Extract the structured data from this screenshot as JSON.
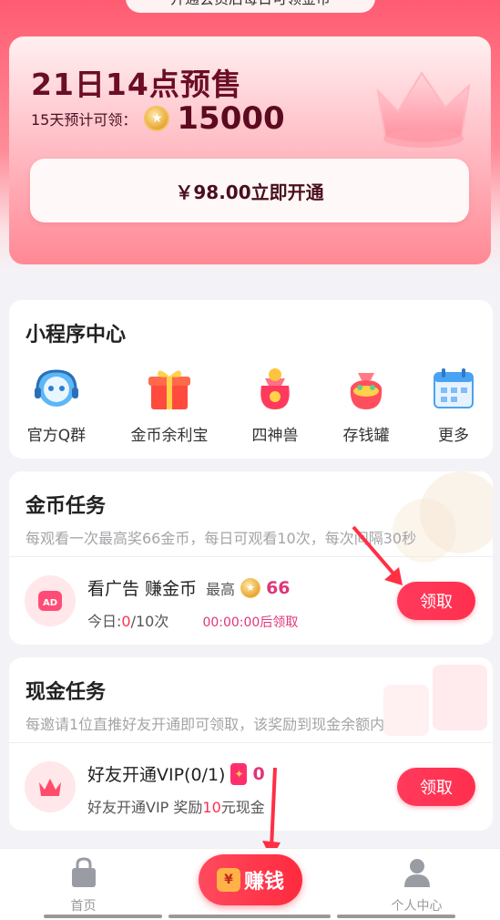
{
  "top_pill": {
    "text": "开通会员后每日可领金币"
  },
  "promo": {
    "title": "21日14点预售",
    "sub_label": "15天预计可领：",
    "amount": "15000",
    "open_button_label": "￥98.00立即开通"
  },
  "mini_center": {
    "title": "小程序中心",
    "items": [
      {
        "label": "官方Q群",
        "icon": "robot-headset-icon"
      },
      {
        "label": "金币余利宝",
        "icon": "gift-box-icon"
      },
      {
        "label": "四神兽",
        "icon": "lucky-bag-icon"
      },
      {
        "label": "存钱罐",
        "icon": "money-bag-icon"
      },
      {
        "label": "更多",
        "icon": "calendar-icon"
      }
    ]
  },
  "coin_task": {
    "title": "金币任务",
    "description": "每观看一次最高奖66金币，每日可观看10次，每次间隔30秒",
    "task": {
      "name": "看广告 赚金币",
      "max_label": "最高",
      "max_value": "66",
      "today_prefix": "今日:",
      "today_done": "0",
      "today_total": "/10次",
      "countdown": "00:00:00后领取",
      "button_label": "领取"
    }
  },
  "cash_task": {
    "title": "现金任务",
    "description": "每邀请1位直推好友开通即可领取，该奖励到现金余额内",
    "task": {
      "name": "好友开通VIP(0/1)",
      "reward_value": "0",
      "detail_prefix": "好友开通VIP 奖励",
      "detail_amount": "10",
      "detail_suffix": "元现金",
      "button_label": "领取"
    }
  },
  "tabbar": {
    "home_label": "首页",
    "earn_label": "赚钱",
    "profile_label": "个人中心"
  },
  "colors": {
    "accent": "#ff2f52",
    "brand_dark": "#6b0d25"
  }
}
